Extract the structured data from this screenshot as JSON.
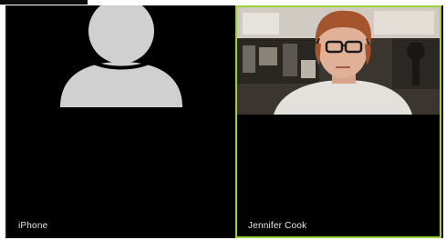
{
  "participants": [
    {
      "name": "iPhone",
      "video_on": false,
      "active_speaker": false
    },
    {
      "name": "Jennifer Cook",
      "video_on": true,
      "active_speaker": true
    }
  ],
  "colors": {
    "active_speaker_border": "#9bd23a",
    "tile_background": "#000000",
    "avatar_fill": "#d0d0d0",
    "label_text": "#e8e8e8"
  },
  "icons": {
    "avatar": "person-silhouette-icon"
  }
}
